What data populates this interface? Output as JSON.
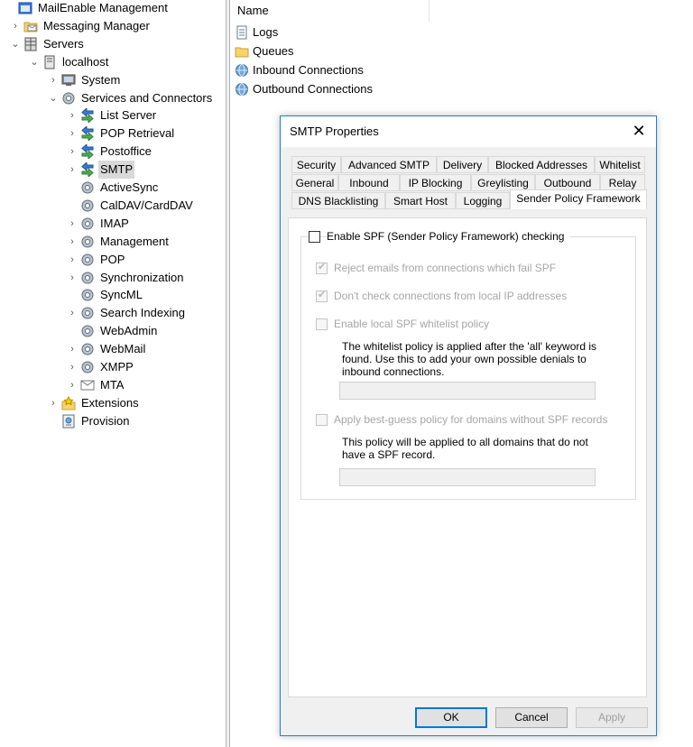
{
  "tree": [
    {
      "label": "MailEnable Management",
      "icon": "management-console-icon",
      "toggle": ""
    },
    {
      "label": "Messaging Manager",
      "icon": "envelope-folder-icon",
      "toggle": "›"
    },
    {
      "label": "Servers",
      "icon": "server-icon",
      "toggle": "⌄"
    },
    {
      "label": "localhost",
      "icon": "host-icon",
      "toggle": "⌄"
    },
    {
      "label": "System",
      "icon": "system-icon",
      "toggle": "›"
    },
    {
      "label": "Services and Connectors",
      "icon": "gear-icon",
      "toggle": "⌄"
    },
    {
      "label": "List Server",
      "icon": "connector-arrows-icon",
      "toggle": "›"
    },
    {
      "label": "POP Retrieval",
      "icon": "connector-arrows-icon",
      "toggle": "›"
    },
    {
      "label": "Postoffice",
      "icon": "connector-arrows-icon",
      "toggle": "›"
    },
    {
      "label": "SMTP",
      "icon": "connector-arrows-icon",
      "toggle": "›"
    },
    {
      "label": "ActiveSync",
      "icon": "gear-icon",
      "toggle": ""
    },
    {
      "label": "CalDAV/CardDAV",
      "icon": "gear-icon",
      "toggle": ""
    },
    {
      "label": "IMAP",
      "icon": "gear-icon",
      "toggle": "›"
    },
    {
      "label": "Management",
      "icon": "gear-icon",
      "toggle": "›"
    },
    {
      "label": "POP",
      "icon": "gear-icon",
      "toggle": "›"
    },
    {
      "label": "Synchronization",
      "icon": "gear-icon",
      "toggle": "›"
    },
    {
      "label": "SyncML",
      "icon": "gear-icon",
      "toggle": ""
    },
    {
      "label": "Search Indexing",
      "icon": "gear-icon",
      "toggle": "›"
    },
    {
      "label": "WebAdmin",
      "icon": "gear-icon",
      "toggle": ""
    },
    {
      "label": "WebMail",
      "icon": "gear-icon",
      "toggle": "›"
    },
    {
      "label": "XMPP",
      "icon": "gear-icon",
      "toggle": "›"
    },
    {
      "label": "MTA",
      "icon": "mail-agent-icon",
      "toggle": "›"
    },
    {
      "label": "Extensions",
      "icon": "extensions-icon",
      "toggle": "›"
    },
    {
      "label": "Provision",
      "icon": "provision-icon",
      "toggle": ""
    }
  ],
  "list": {
    "header": "Name",
    "items": [
      {
        "label": "Logs",
        "icon": "log-file-icon"
      },
      {
        "label": "Queues",
        "icon": "folder-icon"
      },
      {
        "label": "Inbound Connections",
        "icon": "globe-icon"
      },
      {
        "label": "Outbound Connections",
        "icon": "globe-icon"
      }
    ]
  },
  "dialog": {
    "title": "SMTP Properties",
    "close": "✕",
    "tabs_row1": [
      "Security",
      "Advanced SMTP",
      "Delivery",
      "Blocked Addresses",
      "Whitelist"
    ],
    "tabs_row2": [
      "General",
      "Inbound",
      "IP Blocking",
      "Greylisting",
      "Outbound",
      "Relay"
    ],
    "tabs_row3": [
      "DNS Blacklisting",
      "Smart Host",
      "Logging",
      "Sender Policy Framework"
    ],
    "enable_spf": "Enable SPF (Sender Policy Framework) checking",
    "reject_fail": "Reject emails from connections which fail SPF",
    "dont_check_local": "Don't check connections from local IP addresses",
    "enable_whitelist": "Enable local SPF whitelist policy",
    "whitelist_note": "The whitelist policy is applied after the 'all' keyword is found. Use this to add your own possible denials to inbound connections.",
    "best_guess": "Apply best-guess policy for domains without SPF records",
    "best_guess_note": "This policy will be applied to all domains that do not have a SPF record.",
    "ok": "OK",
    "cancel": "Cancel",
    "apply": "Apply"
  }
}
